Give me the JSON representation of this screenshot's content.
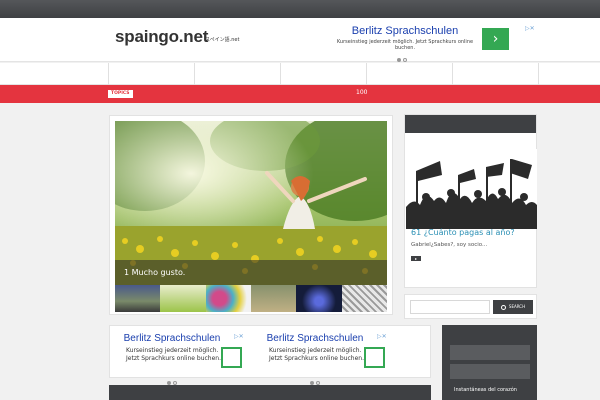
{
  "header": {
    "logo": "spaingo.net",
    "logo_sub": "スペイン語.net",
    "ad": {
      "title": "Berlitz Sprachschulen",
      "description": "Kurseinstieg jederzeit möglich. Jetzt Sprachkurs online buchen.",
      "go_symbol": "›"
    }
  },
  "ticker": {
    "label": "TOPICS",
    "text": "100"
  },
  "slider": {
    "caption": "1 Mucho gusto."
  },
  "sidebar_post": {
    "title": "61 ¿Cuánto pagas al año?",
    "excerpt": "Gabriel¿Sabes?, soy socio..."
  },
  "search": {
    "placeholder": "",
    "button_label": "SEARCH"
  },
  "bottom_ads": [
    {
      "title": "Berlitz Sprachschulen",
      "line1": "Kurseinstieg jederzeit möglich.",
      "line2": "Jetzt Sprachkurs online buchen."
    },
    {
      "title": "Berlitz Sprachschulen",
      "line1": "Kurseinstieg jederzeit möglich.",
      "line2": "Jetzt Sprachkurs online buchen."
    }
  ],
  "dark_sidebar": {
    "item": "Instantáneas del corazón"
  },
  "icons": {
    "ad_choices": "ad-choices-icon",
    "search": "search-icon"
  },
  "colors": {
    "accent_red": "#e4343f",
    "dark": "#3e4043",
    "link_blue": "#2a8fb4",
    "ad_blue": "#1a3fae",
    "ad_green": "#34a853"
  }
}
